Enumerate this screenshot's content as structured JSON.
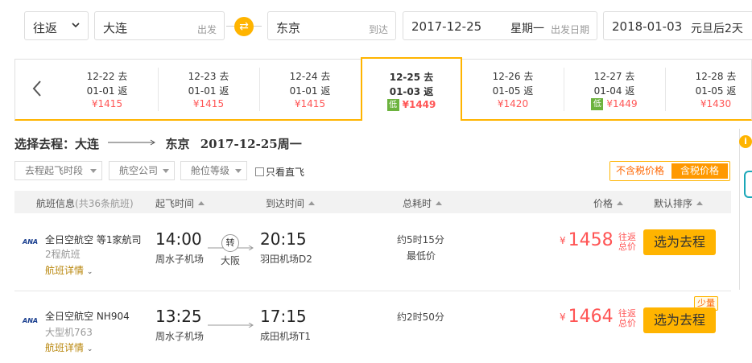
{
  "search": {
    "trip_type": "往返",
    "from_city": "大连",
    "from_hint": "出发",
    "to_city": "东京",
    "to_hint": "到达",
    "depart_date": "2017-12-25",
    "depart_weekday": "星期一",
    "depart_hint": "出发日期",
    "return_date": "2018-01-03",
    "return_note": "元旦后2天"
  },
  "date_strip": [
    {
      "go": "12-22 去",
      "back": "01-01 返",
      "price": "¥1415",
      "low": false
    },
    {
      "go": "12-23 去",
      "back": "01-01 返",
      "price": "¥1415",
      "low": false
    },
    {
      "go": "12-24 去",
      "back": "01-01 返",
      "price": "¥1415",
      "low": false
    },
    {
      "go": "12-25 去",
      "back": "01-03 返",
      "price": "¥1449",
      "low": true,
      "low_label": "低",
      "active": true
    },
    {
      "go": "12-26 去",
      "back": "01-05 返",
      "price": "¥1420",
      "low": false
    },
    {
      "go": "12-27 去",
      "back": "01-04 返",
      "price": "¥1449",
      "low": true,
      "low_label": "低"
    },
    {
      "go": "12-28 去",
      "back": "01-05 返",
      "price": "¥1430",
      "low": false
    }
  ],
  "route": {
    "prefix": "选择去程：",
    "from": "大连",
    "to": "东京",
    "date": "2017-12-25周一"
  },
  "filters": {
    "depart_period": "去程起飞时段",
    "airline": "航空公司",
    "cabin": "舱位等级",
    "direct_only": "只看直飞",
    "tax_excluded": "不含税价格",
    "tax_included": "含税价格"
  },
  "table_header": {
    "flight_info": "航班信息",
    "flight_count": "(共36条航班)",
    "depart_time": "起飞时间",
    "arrive_time": "到达时间",
    "duration": "总耗时",
    "price": "价格",
    "sort": "默认排序"
  },
  "flights": [
    {
      "logo": "ANA",
      "airline": "全日空航空 等1家航司",
      "sub": "2程航班",
      "detail": "航班详情",
      "dep_time": "14:00",
      "dep_airport": "周水子机场",
      "transfer": "转",
      "transfer_city": "大阪",
      "arr_time": "20:15",
      "arr_airport": "羽田机场D2",
      "duration": "约5时15分",
      "duration_note": "最低价",
      "currency": "¥",
      "price": "1458",
      "price_note_1": "往返",
      "price_note_2": "总价",
      "select": "选为去程"
    },
    {
      "logo": "ANA",
      "airline": "全日空航空 NH904",
      "sub": "大型机763",
      "detail": "航班详情",
      "dep_time": "13:25",
      "dep_airport": "周水子机场",
      "arr_time": "17:15",
      "arr_airport": "成田机场T1",
      "duration": "约2时50分",
      "currency": "¥",
      "price": "1464",
      "price_note_1": "往返",
      "price_note_2": "总价",
      "select": "选为去程",
      "badge": "少量"
    }
  ],
  "side_info_icon": "i"
}
